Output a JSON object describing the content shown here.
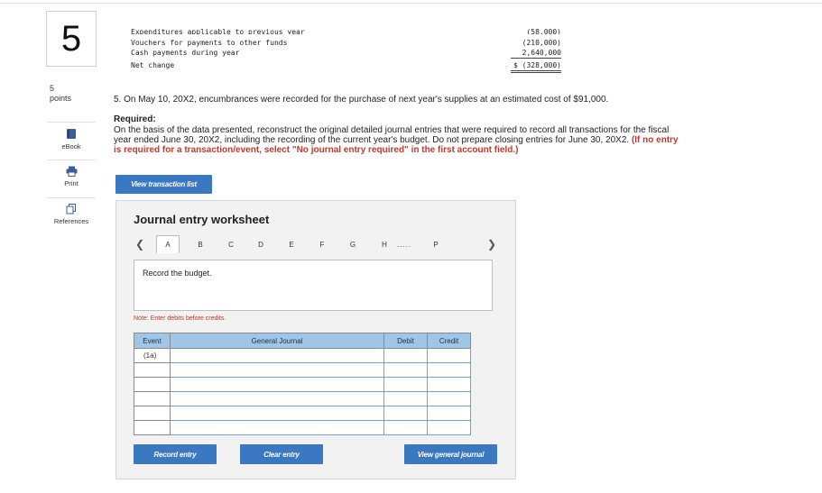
{
  "question": {
    "number": "5",
    "points_value": "5",
    "points_label": "points"
  },
  "tools": [
    {
      "label": "eBook",
      "icon": "book-icon"
    },
    {
      "label": "Print",
      "icon": "print-icon"
    },
    {
      "label": "References",
      "icon": "references-icon"
    }
  ],
  "prior_data": {
    "rows": [
      {
        "label": "Expenditures applicable to previous year",
        "value": "(58,000)"
      },
      {
        "label": "Vouchers for payments to other funds",
        "value": "(210,000)"
      },
      {
        "label": "Cash payments during year",
        "value": "2,640,000"
      },
      {
        "label": "Net change",
        "value": "$ (328,000)"
      }
    ]
  },
  "problem_text": "5. On May 10, 20X2, encumbrances were recorded for the purchase of next year's supplies at an estimated cost of $91,000.",
  "required": {
    "heading": "Required:",
    "body": "On the basis of the data presented, reconstruct the original detailed journal entries that were required to record all transactions for the fiscal year ended June 30, 20X2, including the recording of the current year's budget. Do not prepare closing entries for June 30, 20X2.",
    "instruction": "(If no entry is required for a transaction/event, select \"No journal entry required\" in the first account field.)"
  },
  "buttons": {
    "view_transaction_list": "View transaction list",
    "record_entry": "Record entry",
    "clear_entry": "Clear entry",
    "view_general_journal": "View general journal"
  },
  "worksheet": {
    "title": "Journal entry worksheet",
    "tabs": [
      "A",
      "B",
      "C",
      "D",
      "E",
      "F",
      "G",
      "H",
      ".....",
      "P"
    ],
    "active_tab": "A",
    "record_text": "Record the budget.",
    "note": "Note: Enter debits before credits.",
    "columns": [
      "Event",
      "General Journal",
      "Debit",
      "Credit"
    ],
    "rows": [
      {
        "event": "(1a)"
      },
      {
        "event": ""
      },
      {
        "event": ""
      },
      {
        "event": ""
      },
      {
        "event": ""
      },
      {
        "event": ""
      }
    ]
  },
  "colors": {
    "accent": "#3b78c2",
    "table_header": "#9fc6e6",
    "note_red": "#c0392b"
  }
}
